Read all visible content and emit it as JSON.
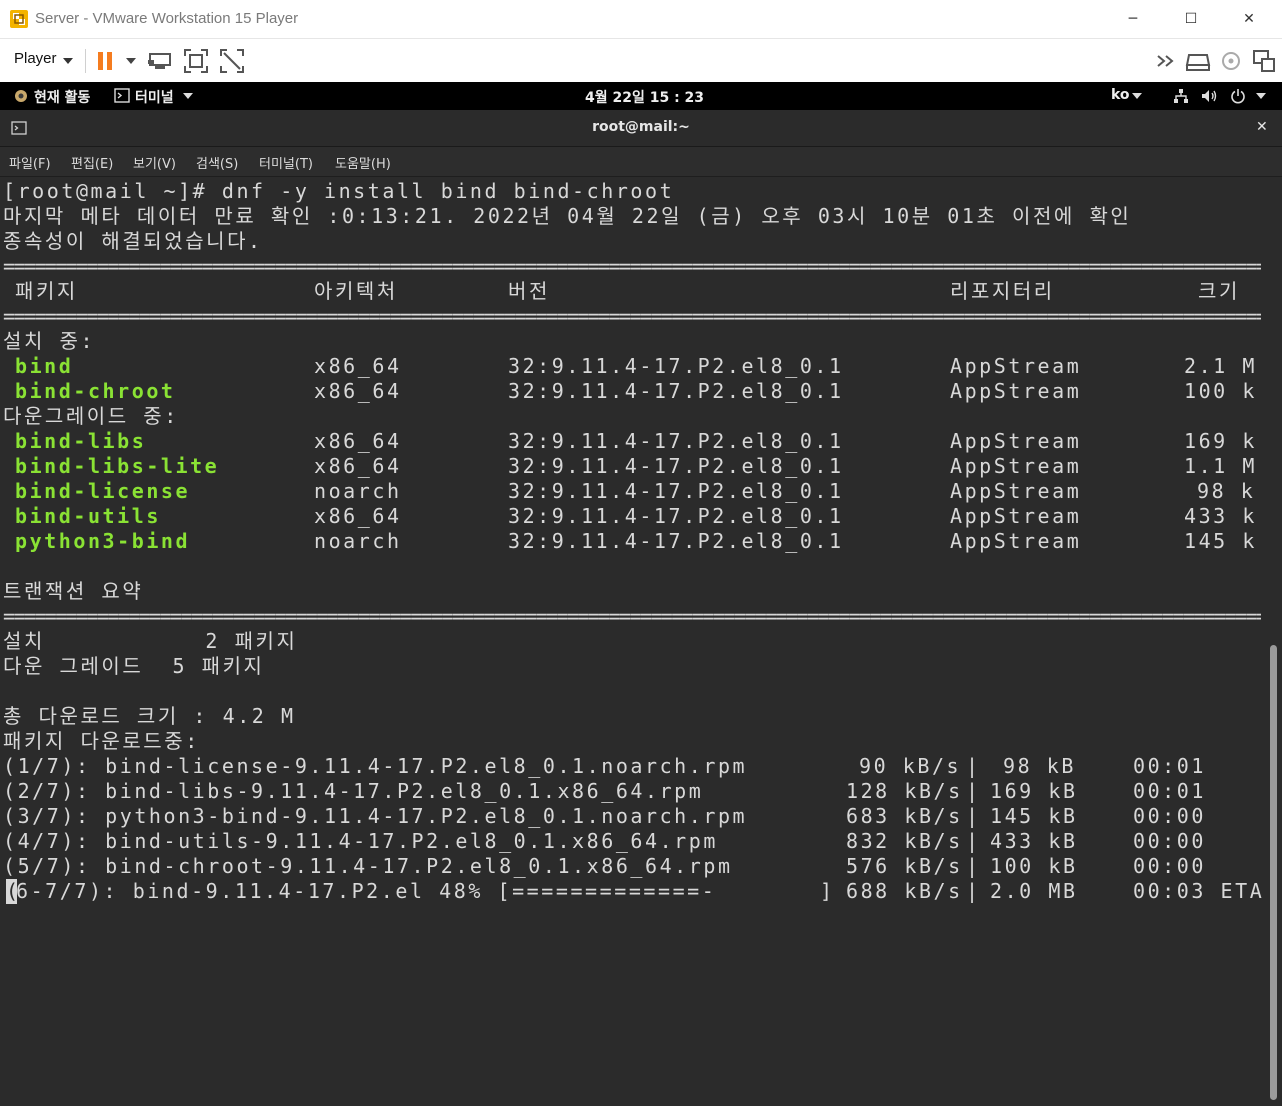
{
  "vmware": {
    "title": "Server - VMware Workstation 15 Player",
    "player_menu": "Player",
    "window_buttons": {
      "minimize": "─",
      "maximize": "☐",
      "close": "✕"
    }
  },
  "gnome": {
    "activities": "현재 활동",
    "app_menu": "터미널",
    "clock": "4월 22일  15 : 23",
    "input_method": "ko"
  },
  "terminal": {
    "title": "root@mail:~",
    "close": "✕",
    "menu": [
      "파일(F)",
      "편집(E)",
      "보기(V)",
      "검색(S)",
      "터미널(T)",
      "도움말(H)"
    ],
    "lines": {
      "prompt": "[root@mail ~]# dnf -y install bind bind-chroot",
      "metadata": "마지막 메타 데이터 만료 확인 :0:13:21. 2022년 04월 22일 (금) 오후 03시 10분 01초 이전에 확인",
      "resolved": "종속성이 해결되었습니다.",
      "separator": "=============================================================================================================================================",
      "header": {
        "package": "패키지",
        "arch": "아키텍처",
        "version": "버전",
        "repo": "리포지터리",
        "size": "크기"
      },
      "installing_label": "설치 중:",
      "installing": [
        {
          "name": "bind",
          "arch": "x86_64",
          "version": "32:9.11.4-17.P2.el8_0.1",
          "repo": "AppStream",
          "size": "2.1 M"
        },
        {
          "name": "bind-chroot",
          "arch": "x86_64",
          "version": "32:9.11.4-17.P2.el8_0.1",
          "repo": "AppStream",
          "size": "100 k"
        }
      ],
      "downgrading_label": "다운그레이드 중:",
      "downgrading": [
        {
          "name": "bind-libs",
          "arch": "x86_64",
          "version": "32:9.11.4-17.P2.el8_0.1",
          "repo": "AppStream",
          "size": "169 k"
        },
        {
          "name": "bind-libs-lite",
          "arch": "x86_64",
          "version": "32:9.11.4-17.P2.el8_0.1",
          "repo": "AppStream",
          "size": "1.1 M"
        },
        {
          "name": "bind-license",
          "arch": "noarch",
          "version": "32:9.11.4-17.P2.el8_0.1",
          "repo": "AppStream",
          "size": "98 k"
        },
        {
          "name": "bind-utils",
          "arch": "x86_64",
          "version": "32:9.11.4-17.P2.el8_0.1",
          "repo": "AppStream",
          "size": "433 k"
        },
        {
          "name": "python3-bind",
          "arch": "noarch",
          "version": "32:9.11.4-17.P2.el8_0.1",
          "repo": "AppStream",
          "size": "145 k"
        }
      ],
      "transaction_summary": "트랜잭션 요약",
      "summary_install": "설치           2 패키지",
      "summary_downgrade": "다운 그레이드  5 패키지",
      "total_download": "총 다운로드 크기 : 4.2 M",
      "downloading": "패키지 다운로드중:",
      "downloads": [
        {
          "file": "(1/7): bind-license-9.11.4-17.P2.el8_0.1.noarch.rpm",
          "rate": "90 kB/s",
          "size": "98 kB",
          "time": "00:01"
        },
        {
          "file": "(2/7): bind-libs-9.11.4-17.P2.el8_0.1.x86_64.rpm",
          "rate": "128 kB/s",
          "size": "169 kB",
          "time": "00:01"
        },
        {
          "file": "(3/7): python3-bind-9.11.4-17.P2.el8_0.1.noarch.rpm",
          "rate": "683 kB/s",
          "size": "145 kB",
          "time": "00:00"
        },
        {
          "file": "(4/7): bind-utils-9.11.4-17.P2.el8_0.1.x86_64.rpm",
          "rate": "832 kB/s",
          "size": "433 kB",
          "time": "00:00"
        },
        {
          "file": "(5/7): bind-chroot-9.11.4-17.P2.el8_0.1.x86_64.rpm",
          "rate": "576 kB/s",
          "size": "100 kB",
          "time": "00:00"
        }
      ],
      "progress": {
        "cursor_char": "(",
        "file": "6-7/7): bind-9.11.4-17.P2.el 48% [=============-",
        "bracket_close": "]",
        "rate": "688 kB/s",
        "size": "2.0 MB",
        "time": "00:03 ETA"
      }
    }
  },
  "colors": {
    "terminal_bg": "#2b2b2b",
    "terminal_fg": "#d8d8d8",
    "package_green": "#8ae234",
    "pause_orange": "#f57c1f"
  }
}
